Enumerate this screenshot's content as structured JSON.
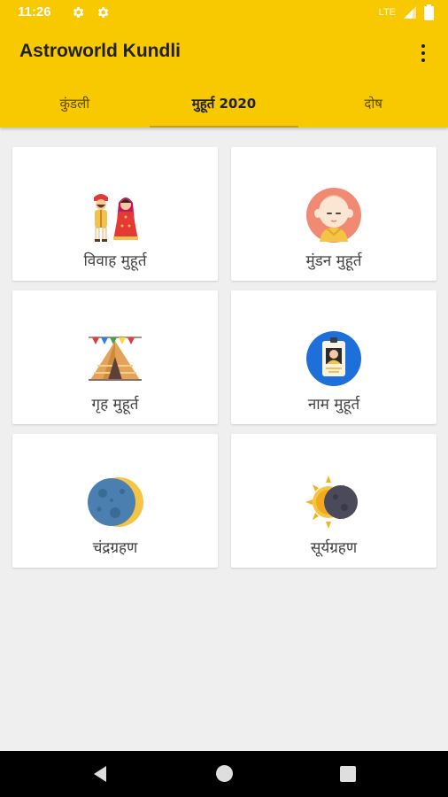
{
  "status_bar": {
    "time": "11:26",
    "network": "LTE",
    "icons": [
      "gear-icon",
      "gear-icon",
      "signal-icon",
      "battery-icon"
    ]
  },
  "app_bar": {
    "title": "Astroworld Kundli",
    "menu_icon": "more-vert-icon"
  },
  "tabs": [
    {
      "label": "कुंडली",
      "active": false
    },
    {
      "label": "मुहूर्त 2020",
      "active": true
    },
    {
      "label": "दोष",
      "active": false
    }
  ],
  "cards": [
    {
      "label": "विवाह मुहूर्त",
      "icon": "wedding-couple-icon"
    },
    {
      "label": "मुंडन मुहूर्त",
      "icon": "baby-face-icon"
    },
    {
      "label": "गृह मुहूर्त",
      "icon": "tent-house-icon"
    },
    {
      "label": "नाम मुहूर्त",
      "icon": "name-badge-icon"
    },
    {
      "label": "चंद्रग्रहण",
      "icon": "lunar-eclipse-icon"
    },
    {
      "label": "सूर्यग्रहण",
      "icon": "solar-eclipse-icon"
    }
  ],
  "colors": {
    "primary": "#f8c800",
    "background": "#efefef",
    "card": "#ffffff",
    "text": "#424242"
  },
  "nav_bar": {
    "icons": [
      "back-icon",
      "home-icon",
      "recents-icon"
    ]
  }
}
